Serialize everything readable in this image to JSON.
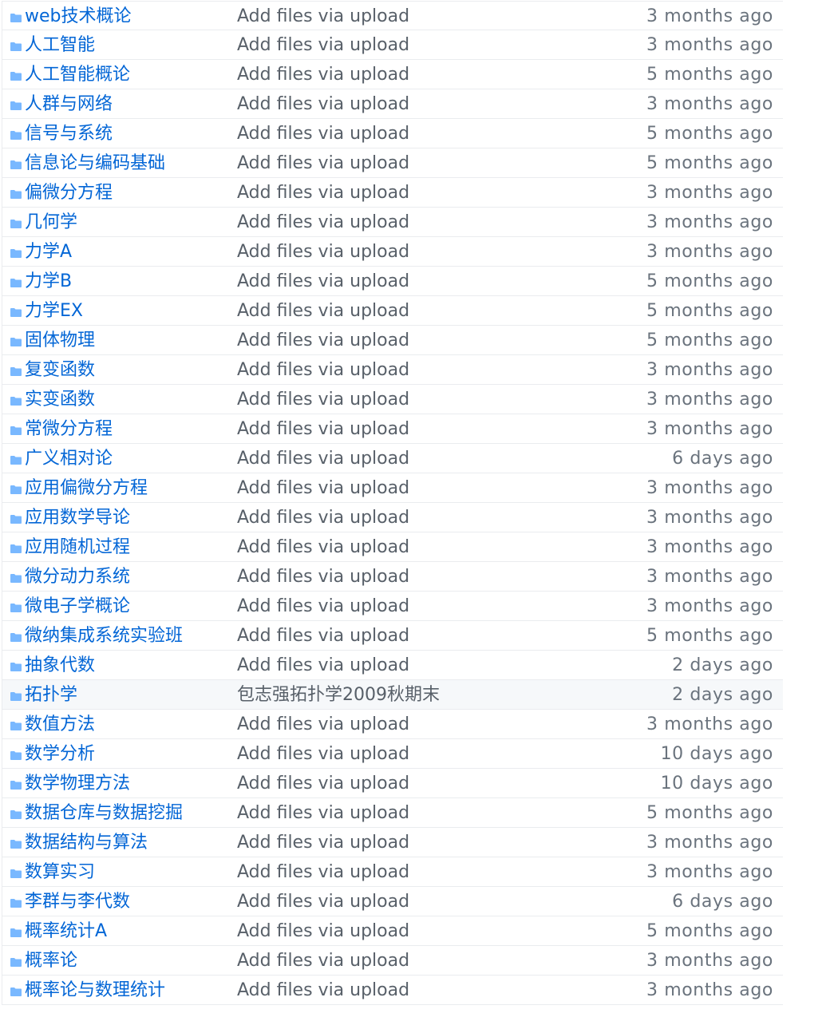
{
  "file_list": {
    "rows": [
      {
        "name": "web技术概论",
        "message": "Add files via upload",
        "age": "3 months ago"
      },
      {
        "name": "人工智能",
        "message": "Add files via upload",
        "age": "3 months ago"
      },
      {
        "name": "人工智能概论",
        "message": "Add files via upload",
        "age": "5 months ago"
      },
      {
        "name": "人群与网络",
        "message": "Add files via upload",
        "age": "3 months ago"
      },
      {
        "name": "信号与系统",
        "message": "Add files via upload",
        "age": "5 months ago"
      },
      {
        "name": "信息论与编码基础",
        "message": "Add files via upload",
        "age": "5 months ago"
      },
      {
        "name": "偏微分方程",
        "message": "Add files via upload",
        "age": "3 months ago"
      },
      {
        "name": "几何学",
        "message": "Add files via upload",
        "age": "3 months ago"
      },
      {
        "name": "力学A",
        "message": "Add files via upload",
        "age": "3 months ago"
      },
      {
        "name": "力学B",
        "message": "Add files via upload",
        "age": "5 months ago"
      },
      {
        "name": "力学EX",
        "message": "Add files via upload",
        "age": "5 months ago"
      },
      {
        "name": "固体物理",
        "message": "Add files via upload",
        "age": "5 months ago"
      },
      {
        "name": "复变函数",
        "message": "Add files via upload",
        "age": "3 months ago"
      },
      {
        "name": "实变函数",
        "message": "Add files via upload",
        "age": "3 months ago"
      },
      {
        "name": "常微分方程",
        "message": "Add files via upload",
        "age": "3 months ago"
      },
      {
        "name": "广义相对论",
        "message": "Add files via upload",
        "age": "6 days ago"
      },
      {
        "name": "应用偏微分方程",
        "message": "Add files via upload",
        "age": "3 months ago"
      },
      {
        "name": "应用数学导论",
        "message": "Add files via upload",
        "age": "3 months ago"
      },
      {
        "name": "应用随机过程",
        "message": "Add files via upload",
        "age": "3 months ago"
      },
      {
        "name": "微分动力系统",
        "message": "Add files via upload",
        "age": "3 months ago"
      },
      {
        "name": "微电子学概论",
        "message": "Add files via upload",
        "age": "3 months ago"
      },
      {
        "name": "微纳集成系统实验班",
        "message": "Add files via upload",
        "age": "5 months ago"
      },
      {
        "name": "抽象代数",
        "message": "Add files via upload",
        "age": "2 days ago"
      },
      {
        "name": "拓扑学",
        "message": "包志强拓扑学2009秋期末",
        "age": "2 days ago",
        "highlighted": true
      },
      {
        "name": "数值方法",
        "message": "Add files via upload",
        "age": "3 months ago"
      },
      {
        "name": "数学分析",
        "message": "Add files via upload",
        "age": "10 days ago"
      },
      {
        "name": "数学物理方法",
        "message": "Add files via upload",
        "age": "10 days ago"
      },
      {
        "name": "数据仓库与数据挖掘",
        "message": "Add files via upload",
        "age": "5 months ago"
      },
      {
        "name": "数据结构与算法",
        "message": "Add files via upload",
        "age": "3 months ago"
      },
      {
        "name": "数算实习",
        "message": "Add files via upload",
        "age": "3 months ago"
      },
      {
        "name": "李群与李代数",
        "message": "Add files via upload",
        "age": "6 days ago"
      },
      {
        "name": "概率统计A",
        "message": "Add files via upload",
        "age": "5 months ago"
      },
      {
        "name": "概率论",
        "message": "Add files via upload",
        "age": "3 months ago"
      },
      {
        "name": "概率论与数理统计",
        "message": "Add files via upload",
        "age": "3 months ago"
      }
    ]
  },
  "icons": {
    "row_icon": "folder-icon"
  },
  "colors": {
    "link": "#0366d6",
    "message": "#586069",
    "age": "#6a737d",
    "folder_icon": "#79b8ff",
    "row_border": "#eaecef",
    "row_highlight": "#f6f8fa"
  }
}
